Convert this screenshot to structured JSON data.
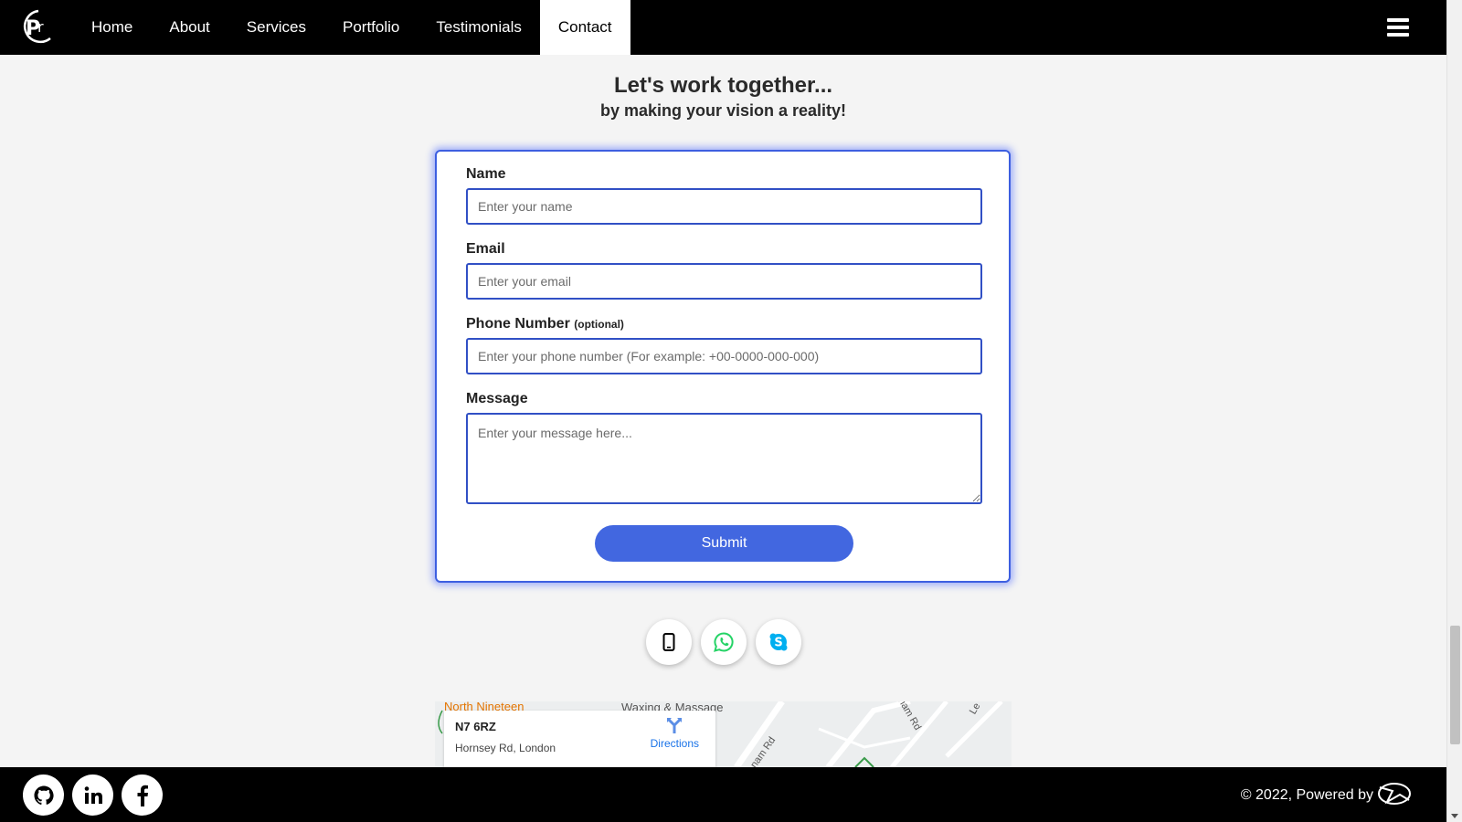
{
  "nav": {
    "items": [
      {
        "label": "Home"
      },
      {
        "label": "About"
      },
      {
        "label": "Services"
      },
      {
        "label": "Portfolio"
      },
      {
        "label": "Testimonials"
      },
      {
        "label": "Contact"
      }
    ],
    "active": "Contact"
  },
  "hero": {
    "heading": "Let's work together...",
    "subheading": "by making your vision a reality!"
  },
  "form": {
    "name_label": "Name",
    "name_placeholder": "Enter your name",
    "email_label": "Email",
    "email_placeholder": "Enter your email",
    "phone_label": "Phone Number",
    "phone_optional": "(optional)",
    "phone_placeholder": "Enter your phone number (For example: +00-0000-000-000)",
    "message_label": "Message",
    "message_placeholder": "Enter your message here...",
    "submit_label": "Submit"
  },
  "contact_icons": [
    "phone-icon",
    "whatsapp-icon",
    "skype-icon"
  ],
  "map": {
    "title": "N7 6RZ",
    "address": "Hornsey Rd, London",
    "directions_label": "Directions",
    "poi_label": "North Nineteen",
    "place_label": "Waxing & Massage",
    "road_label_1": "nam Rd",
    "road_label_2": "ham Rd",
    "road_label_3": "Le"
  },
  "footer": {
    "social_icons": [
      "github-icon",
      "linkedin-icon",
      "facebook-icon"
    ],
    "copyright": "© 2022, Powered by"
  },
  "colors": {
    "accent": "#4267e0",
    "nav_bg": "#000000",
    "footer_bg": "#000000",
    "card_border": "#3d5fe0"
  }
}
